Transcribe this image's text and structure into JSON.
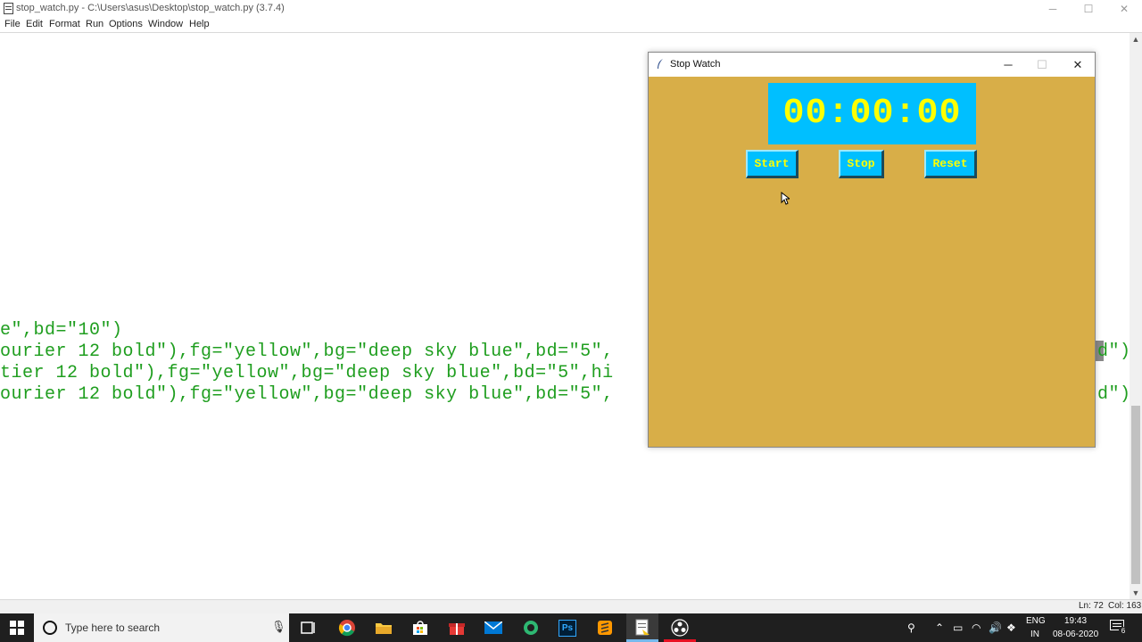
{
  "editor": {
    "title": "stop_watch.py - C:\\Users\\asus\\Desktop\\stop_watch.py (3.7.4)",
    "menu": [
      "File",
      "Edit",
      "Format",
      "Run",
      "Options",
      "Window",
      "Help"
    ],
    "code_lines": [
      "e\",bd=\"10\")",
      "ourier 12 bold\"),fg=\"yellow\",bg=\"deep sky blue\",bd=\"5\",",
      "tier 12 bold\"),fg=\"yellow\",bg=\"deep sky blue\",bd=\"5\",hi",
      "ourier 12 bold\"),fg=\"yellow\",bg=\"deep sky blue\",bd=\"5\","
    ],
    "code_tails": [
      "\")",
      "d\")",
      "\")",
      "d\")"
    ],
    "status": {
      "line": "Ln: 72",
      "col": "Col: 163"
    },
    "controls": {
      "minimize": "─",
      "maximize": "☐",
      "close": "✕"
    }
  },
  "stopwatch": {
    "title": "Stop Watch",
    "display": "00:00:00",
    "buttons": {
      "start": "Start",
      "stop": "Stop",
      "reset": "Reset"
    },
    "controls": {
      "minimize": "─",
      "maximize": "☐",
      "close": "✕"
    },
    "colors": {
      "background": "#d8ae48",
      "button_bg": "#00bfff",
      "button_fg": "#ffff00"
    }
  },
  "taskbar": {
    "search_placeholder": "Type here to search",
    "apps": [
      "task-view-icon",
      "chrome-icon",
      "file-explorer-icon",
      "store-icon",
      "gift-icon",
      "mail-icon",
      "app-green-icon",
      "photoshop-icon",
      "sublime-icon",
      "idle-icon",
      "obs-icon"
    ],
    "photoshop_label": "Ps",
    "tray": {
      "lang_top": "ENG",
      "lang_bottom": "IN",
      "time": "19:43",
      "date": "08-06-2020",
      "notifications": "6"
    }
  }
}
